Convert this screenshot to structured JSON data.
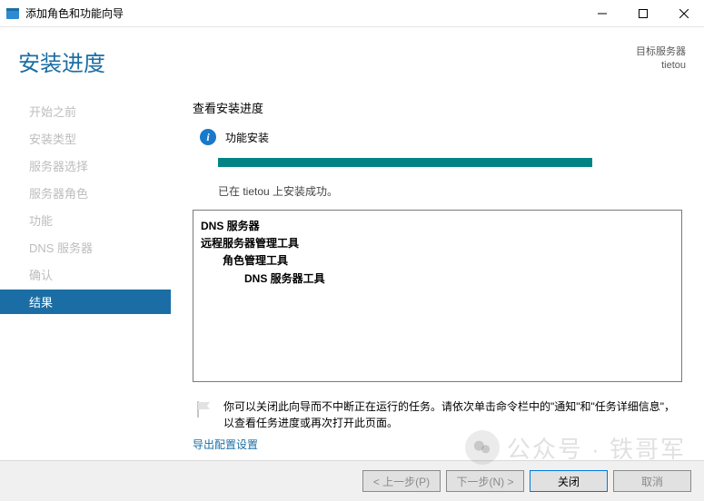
{
  "window": {
    "title": "添加角色和功能向导"
  },
  "header": {
    "title": "安装进度",
    "target_label": "目标服务器",
    "target_value": "tietou"
  },
  "nav": {
    "items": [
      {
        "label": "开始之前",
        "active": false
      },
      {
        "label": "安装类型",
        "active": false
      },
      {
        "label": "服务器选择",
        "active": false
      },
      {
        "label": "服务器角色",
        "active": false
      },
      {
        "label": "功能",
        "active": false
      },
      {
        "label": "DNS 服务器",
        "active": false
      },
      {
        "label": "确认",
        "active": false
      },
      {
        "label": "结果",
        "active": true
      }
    ]
  },
  "main": {
    "section_title": "查看安装进度",
    "status_label": "功能安装",
    "progress_percent": 100,
    "success_text": "已在 tietou 上安装成功。",
    "results": [
      {
        "level": 0,
        "text": "DNS 服务器"
      },
      {
        "level": 1,
        "text": "远程服务器管理工具"
      },
      {
        "level": 2,
        "text": "角色管理工具"
      },
      {
        "level": 3,
        "text": "DNS 服务器工具"
      }
    ],
    "note_text": "你可以关闭此向导而不中断正在运行的任务。请依次单击命令栏中的\"通知\"和\"任务详细信息\"，以查看任务进度或再次打开此页面。",
    "export_link": "导出配置设置"
  },
  "footer": {
    "prev": "< 上一步(P)",
    "next": "下一步(N) >",
    "close": "关闭",
    "cancel": "取消"
  },
  "watermark": {
    "text": "公众号 · 铁哥军"
  }
}
